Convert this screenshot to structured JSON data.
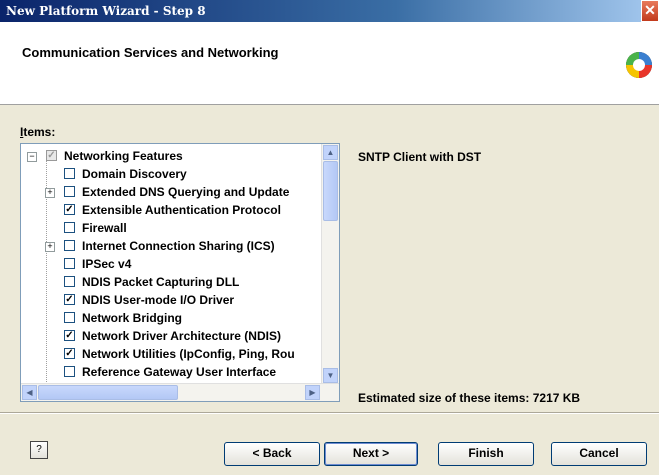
{
  "window": {
    "title": "New Platform Wizard - Step 8",
    "close_symbol": "✕"
  },
  "header": {
    "title": "Communication Services and Networking"
  },
  "items": {
    "label_prefix": "I",
    "label_rest": "tems:",
    "rows": [
      {
        "label": "Networking Features",
        "level": 0,
        "expander": "−",
        "checkbox": "partial",
        "mark": "✓"
      },
      {
        "label": "Domain Discovery",
        "level": 1,
        "expander": "",
        "checkbox": "unchecked",
        "mark": ""
      },
      {
        "label": "Extended DNS Querying and Update",
        "level": 1,
        "expander": "+",
        "checkbox": "unchecked",
        "mark": ""
      },
      {
        "label": "Extensible Authentication Protocol",
        "level": 1,
        "expander": "",
        "checkbox": "checked",
        "mark": "✓"
      },
      {
        "label": "Firewall",
        "level": 1,
        "expander": "",
        "checkbox": "unchecked",
        "mark": ""
      },
      {
        "label": "Internet Connection Sharing (ICS)",
        "level": 1,
        "expander": "+",
        "checkbox": "unchecked",
        "mark": ""
      },
      {
        "label": "IPSec v4",
        "level": 1,
        "expander": "",
        "checkbox": "unchecked",
        "mark": ""
      },
      {
        "label": "NDIS Packet Capturing DLL",
        "level": 1,
        "expander": "",
        "checkbox": "unchecked",
        "mark": ""
      },
      {
        "label": "NDIS User-mode I/O Driver",
        "level": 1,
        "expander": "",
        "checkbox": "checked",
        "mark": "✓"
      },
      {
        "label": "Network Bridging",
        "level": 1,
        "expander": "",
        "checkbox": "unchecked",
        "mark": ""
      },
      {
        "label": "Network Driver Architecture (NDIS)",
        "level": 1,
        "expander": "",
        "checkbox": "checked",
        "mark": "✓"
      },
      {
        "label": "Network Utilities (IpConfig, Ping, Rou",
        "level": 1,
        "expander": "",
        "checkbox": "checked",
        "mark": "✓"
      },
      {
        "label": "Reference Gateway User Interface",
        "level": 1,
        "expander": "",
        "checkbox": "unchecked",
        "mark": ""
      }
    ]
  },
  "scroll": {
    "up": "▲",
    "down": "▼",
    "left": "◀",
    "right": "▶"
  },
  "description": "SNTP Client with DST",
  "estimated_size": "Estimated size of these items: 7217 KB",
  "buttons": {
    "help": "?",
    "back": "< Back",
    "next": "Next >",
    "finish": "Finish",
    "cancel": "Cancel"
  },
  "colors": {
    "title_bar": "#0a246a",
    "dialog_bg": "#ece9d8",
    "button_border": "#003c74"
  },
  "icons": {
    "logo": "windows-embedded-logo-icon",
    "help": "help-icon"
  }
}
